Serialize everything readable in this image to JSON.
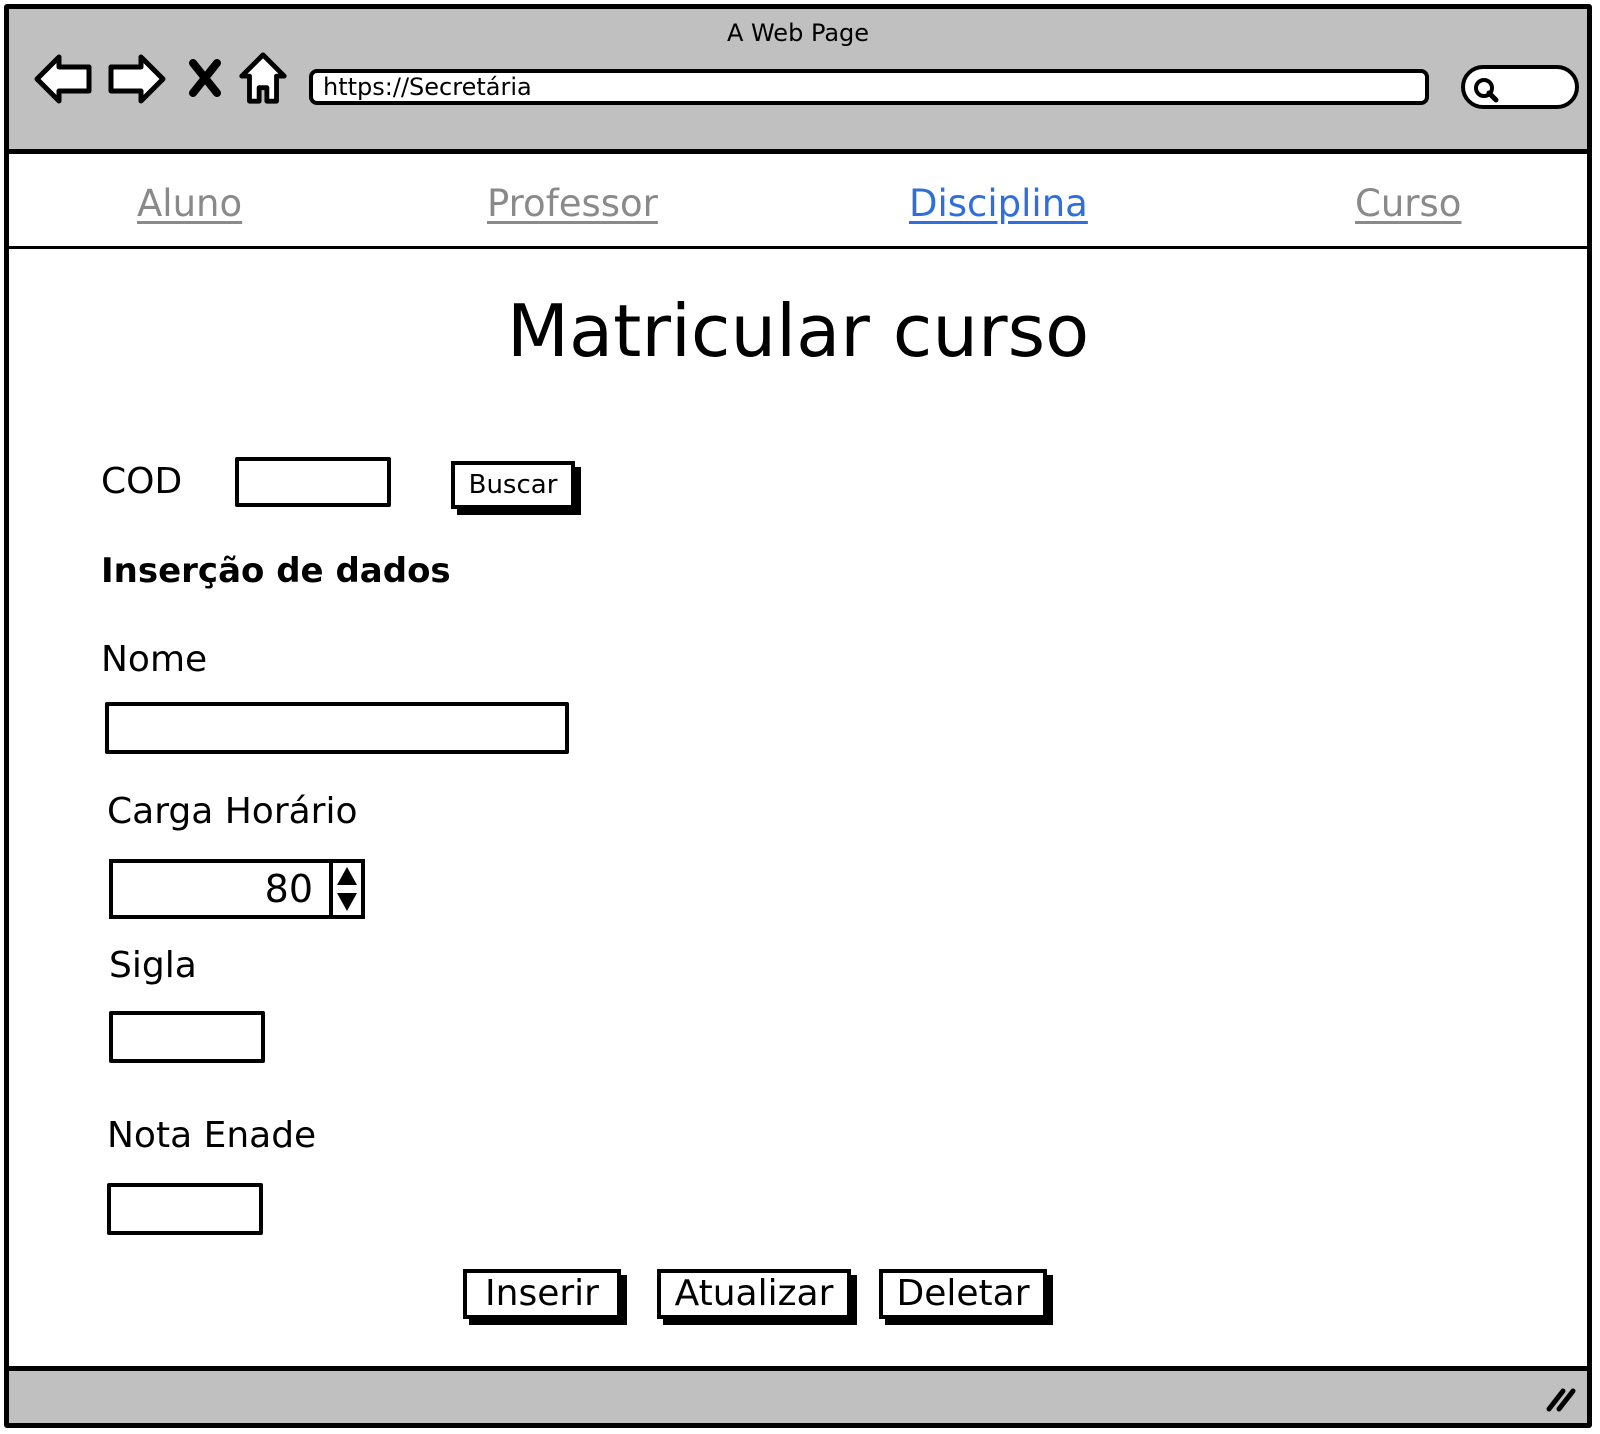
{
  "window": {
    "title": "A Web Page",
    "url": "https://Secretária"
  },
  "nav": {
    "links": [
      {
        "label": "Aluno",
        "active": false
      },
      {
        "label": "Professor",
        "active": false
      },
      {
        "label": "Disciplina",
        "active": true
      },
      {
        "label": "Curso",
        "active": false
      }
    ]
  },
  "page": {
    "title": "Matricular curso"
  },
  "form": {
    "cod_label": "COD",
    "cod_value": "",
    "search_button": "Buscar",
    "section_title": "Inserção de dados",
    "nome_label": "Nome",
    "nome_value": "",
    "carga_label": "Carga Horário",
    "carga_value": "80",
    "sigla_label": "Sigla",
    "sigla_value": "",
    "enade_label": "Nota Enade",
    "enade_value": ""
  },
  "actions": {
    "insert": "Inserir",
    "update": "Atualizar",
    "delete": "Deletar"
  },
  "colors": {
    "chrome": "#c0c0c0",
    "active_link": "#2f6fdc",
    "inactive_link": "#8a8a8a"
  },
  "icons": [
    "back-icon",
    "forward-icon",
    "stop-icon",
    "home-icon",
    "search-icon",
    "resize-grip-icon"
  ]
}
